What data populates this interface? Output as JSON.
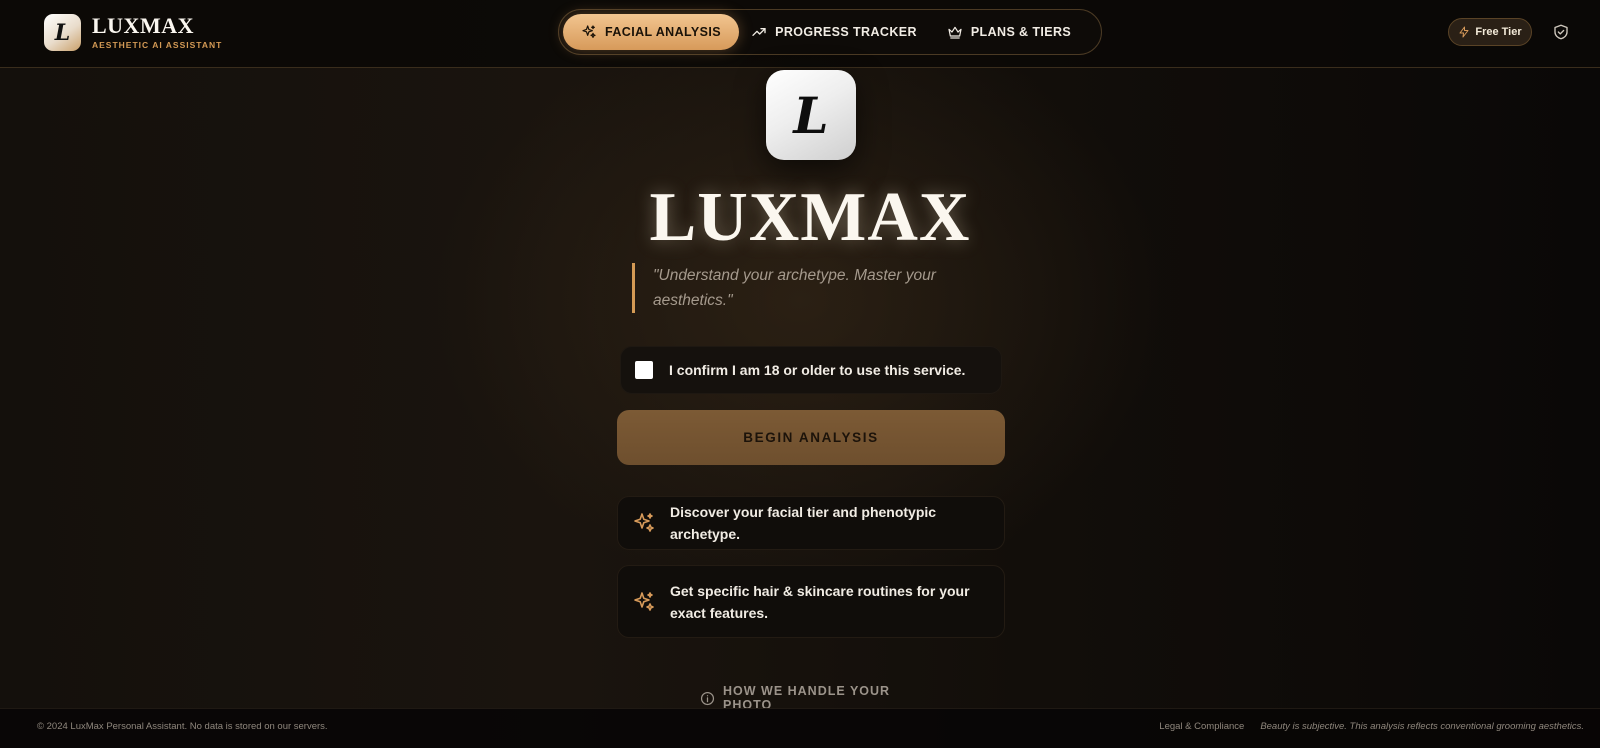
{
  "brand": {
    "logo_letter": "L",
    "name": "LUXMAX",
    "tagline": "AESTHETIC AI ASSISTANT"
  },
  "nav": {
    "items": [
      {
        "label": "FACIAL ANALYSIS",
        "icon": "sparkles-icon",
        "active": true
      },
      {
        "label": "PROGRESS TRACKER",
        "icon": "trending-up-icon",
        "active": false
      },
      {
        "label": "PLANS & TIERS",
        "icon": "crown-icon",
        "active": false
      }
    ]
  },
  "header_right": {
    "tier_label": "Free Tier",
    "tier_icon": "lightning-icon",
    "shield_icon": "shield-check-icon"
  },
  "hero": {
    "logo_letter": "L",
    "title": "LUXMAX",
    "quote": "\"Understand your archetype. Master your aesthetics.\""
  },
  "confirm": {
    "label": "I confirm I am 18 or older to use this service.",
    "checked": false
  },
  "begin_button": {
    "label": "BEGIN ANALYSIS"
  },
  "features": [
    {
      "icon": "sparkles-icon",
      "text": "Discover your facial tier and phenotypic archetype."
    },
    {
      "icon": "sparkles-icon",
      "text": "Get specific hair & skincare routines for your exact features."
    }
  ],
  "photo_link": {
    "icon": "info-icon",
    "label": "HOW WE HANDLE YOUR PHOTO"
  },
  "footer": {
    "copyright": "© 2024 LuxMax Personal Assistant. No data is stored on our servers.",
    "legal": "Legal & Compliance",
    "disclaimer": "Beauty is subjective. This analysis reflects conventional grooming aesthetics."
  },
  "colors": {
    "accent": "#d79a5a",
    "accent_light": "#f2c590",
    "background": "#0b0907",
    "button_muted": "#7c5a35"
  }
}
